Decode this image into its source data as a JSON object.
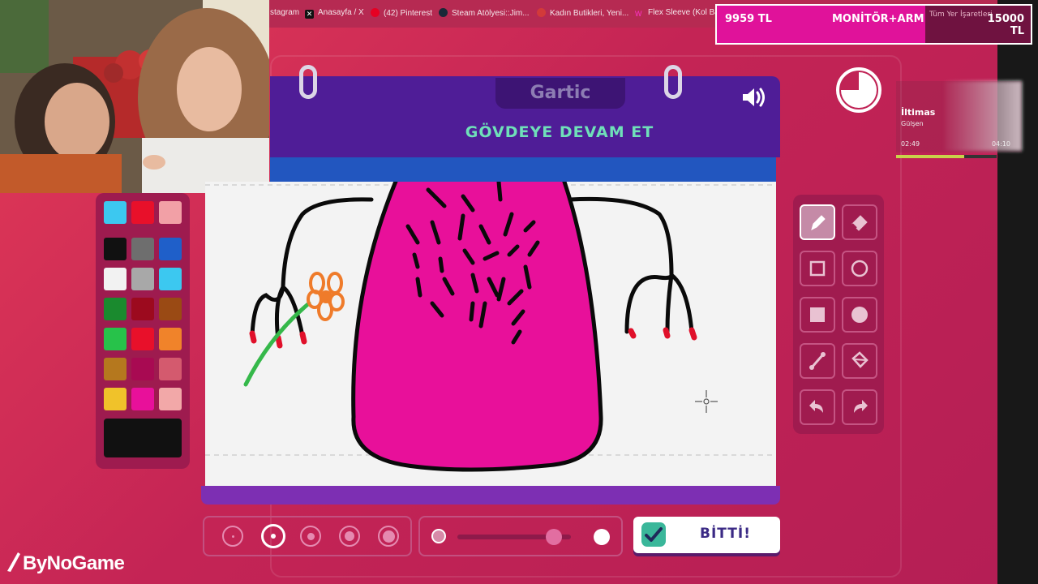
{
  "bookmarks": [
    {
      "label": "stagram",
      "icon": "instagram-icon"
    },
    {
      "label": "Anasayfa / X",
      "icon": "x-icon"
    },
    {
      "label": "(42) Pinterest",
      "icon": "pinterest-icon"
    },
    {
      "label": "Steam Atölyesi::Jim...",
      "icon": "steam-icon"
    },
    {
      "label": "Kadın Butikleri, Yeni...",
      "icon": "globe-icon"
    },
    {
      "label": "Flex Sleeve (Kol Ban...",
      "icon": "bookmark-icon"
    }
  ],
  "bookmarks_other": "Tüm Yer İşaretleri",
  "donation": {
    "current": "9959 TL",
    "goal_title": "MONİTÖR+ARM",
    "target": "15000 TL",
    "progress_fraction": 0.6639,
    "fill_color": "#e0129a"
  },
  "game": {
    "logo": "Gartic",
    "prompt": "GÖVDEYE DEVAM ET",
    "done_button": "BİTTİ!",
    "sound_icon": "speaker-icon",
    "timer_icon": "clock-icon",
    "timer_remaining_fraction": 0.75
  },
  "palette": {
    "top_colors": [
      "#3cc8f0",
      "#e8102a",
      "#f2a0a6"
    ],
    "colors": [
      "#111111",
      "#6e6e6e",
      "#1f5fc9",
      "#f2f2f2",
      "#a8a8a8",
      "#3cc8f0",
      "#1a8a2e",
      "#9c0a1e",
      "#9a4a14",
      "#27c24a",
      "#e8102a",
      "#f0832a",
      "#b5781e",
      "#a80a52",
      "#d45a6e",
      "#f0c22a",
      "#e8109a",
      "#f2a8a8"
    ],
    "selected_color": "#111111"
  },
  "tools": [
    {
      "name": "pencil-tool",
      "icon": "pencil-icon",
      "active": true
    },
    {
      "name": "eraser-tool",
      "icon": "eraser-icon",
      "active": false
    },
    {
      "name": "rectangle-outline-tool",
      "icon": "square-outline-icon",
      "active": false
    },
    {
      "name": "ellipse-outline-tool",
      "icon": "circle-outline-icon",
      "active": false
    },
    {
      "name": "rectangle-fill-tool",
      "icon": "square-fill-icon",
      "active": false
    },
    {
      "name": "ellipse-fill-tool",
      "icon": "circle-fill-icon",
      "active": false
    },
    {
      "name": "line-tool",
      "icon": "line-icon",
      "active": false
    },
    {
      "name": "fill-bucket-tool",
      "icon": "bucket-icon",
      "active": false
    },
    {
      "name": "undo-tool",
      "icon": "undo-icon",
      "active": false
    },
    {
      "name": "redo-tool",
      "icon": "redo-icon",
      "active": false
    }
  ],
  "brush_sizes": {
    "count": 5,
    "selected_index": 1
  },
  "opacity_level": 0.85,
  "music": {
    "title": "İltimas",
    "artist": "Gülşen",
    "elapsed": "02:49",
    "total": "04:10",
    "progress_fraction": 0.676
  },
  "brand": "ByNoGame"
}
